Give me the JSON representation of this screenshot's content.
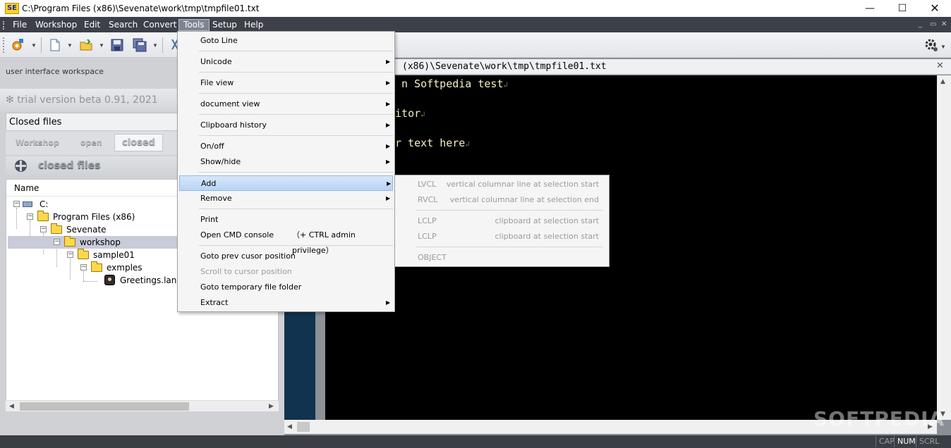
{
  "window": {
    "title": "C:\\Program Files (x86)\\Sevenate\\work\\tmp\\tmpfile01.txt",
    "logo": "SE",
    "controls": {
      "minimize": "—",
      "maximize": "☐",
      "close": "✕"
    }
  },
  "menubar": {
    "items": [
      {
        "label": "File"
      },
      {
        "label": "Workshop"
      },
      {
        "label": "Edit"
      },
      {
        "label": "Search"
      },
      {
        "label": "Convert"
      },
      {
        "label": "Tools",
        "active": true
      },
      {
        "label": "Setup"
      },
      {
        "label": "Help"
      }
    ],
    "mdi": {
      "minimize": "_",
      "restore": "▭",
      "close": "✕"
    }
  },
  "toolbar": {
    "icons": [
      "new-workshop-icon",
      "new-file-icon",
      "open-folder-icon",
      "save-icon",
      "save-all-icon",
      "cut-icon",
      "settings-gear-icon"
    ]
  },
  "left_panel": {
    "workspace_label": "user interface workspace",
    "trial_text": "trial version beta 0.91, 2021",
    "closed_header": "Closed files",
    "tabs": [
      {
        "label": "Workshop"
      },
      {
        "label": "open"
      },
      {
        "label": "closed",
        "selected": true
      }
    ],
    "section_title": "closed files",
    "tree": {
      "column": "Name",
      "nodes": [
        {
          "label": "C:",
          "level": 0,
          "type": "drive"
        },
        {
          "label": "Program Files (x86)",
          "level": 1,
          "type": "folder"
        },
        {
          "label": "Sevenate",
          "level": 2,
          "type": "folder"
        },
        {
          "label": "workshop",
          "level": 3,
          "type": "folder",
          "selected": true
        },
        {
          "label": "sample01",
          "level": 4,
          "type": "folder"
        },
        {
          "label": "exmples",
          "level": 5,
          "type": "folder"
        },
        {
          "label": "Greetings.langu",
          "level": 6,
          "type": "file"
        }
      ]
    }
  },
  "editor": {
    "path": "(x86)\\Sevenate\\work\\tmp\\tmpfile01.txt",
    "close": "✕",
    "lines": [
      {
        "text": "n Softpedia test"
      },
      {
        "text": "ditor"
      },
      {
        "text": "r text here"
      }
    ],
    "eol_mark": "↲",
    "watermark": "SOFTPEDIA"
  },
  "statusbar": {
    "cells": [
      {
        "label": "CAP",
        "on": false
      },
      {
        "label": "NUM",
        "on": true
      },
      {
        "label": "SCRL",
        "on": false
      }
    ]
  },
  "tools_menu": {
    "items": [
      {
        "label": "Goto Line",
        "sub": false,
        "disabled": false
      },
      {
        "label": "Unicode",
        "sub": true,
        "disabled": false
      },
      {
        "label": "File view",
        "sub": true,
        "disabled": false
      },
      {
        "label": "document view",
        "sub": true,
        "disabled": false
      },
      {
        "label": "Clipboard history",
        "sub": true,
        "disabled": false
      },
      {
        "label": "On/off",
        "sub": true,
        "disabled": false
      },
      {
        "label": "Show/hide",
        "sub": true,
        "disabled": false
      },
      {
        "label": "Add",
        "sub": true,
        "disabled": false,
        "highlighted": true
      },
      {
        "label": "Remove",
        "sub": true,
        "disabled": false
      },
      {
        "label": "Print",
        "sub": false,
        "disabled": false
      },
      {
        "label": "Open CMD console",
        "shortcut": "（+ CTRL admin privilege）",
        "sub": false,
        "disabled": false
      },
      {
        "label": "Goto prev cusor position",
        "sub": false,
        "disabled": false
      },
      {
        "label": "Scroll to cursor position",
        "sub": false,
        "disabled": true
      },
      {
        "label": "Goto temporary file folder",
        "sub": false,
        "disabled": false
      },
      {
        "label": "Extract",
        "sub": true,
        "disabled": false
      }
    ],
    "arrow": "▶"
  },
  "add_submenu": {
    "items": [
      {
        "label": "LVCL",
        "desc": "vertical columnar line at selection start"
      },
      {
        "label": "RVCL",
        "desc": "vertical columnar line at selection end"
      },
      {
        "label": "LCLP",
        "desc": "clipboard at selection start"
      },
      {
        "label": "LCLP",
        "desc": "clipboard at selection start"
      },
      {
        "label": "OBJECT",
        "desc": ""
      }
    ]
  },
  "colors": {
    "menubar_bg": "#3c4048",
    "editor_bg": "#000000",
    "editor_text": "#f3efc4",
    "gutter": "#11334e",
    "menu_highlight": "#b9d4f4"
  }
}
